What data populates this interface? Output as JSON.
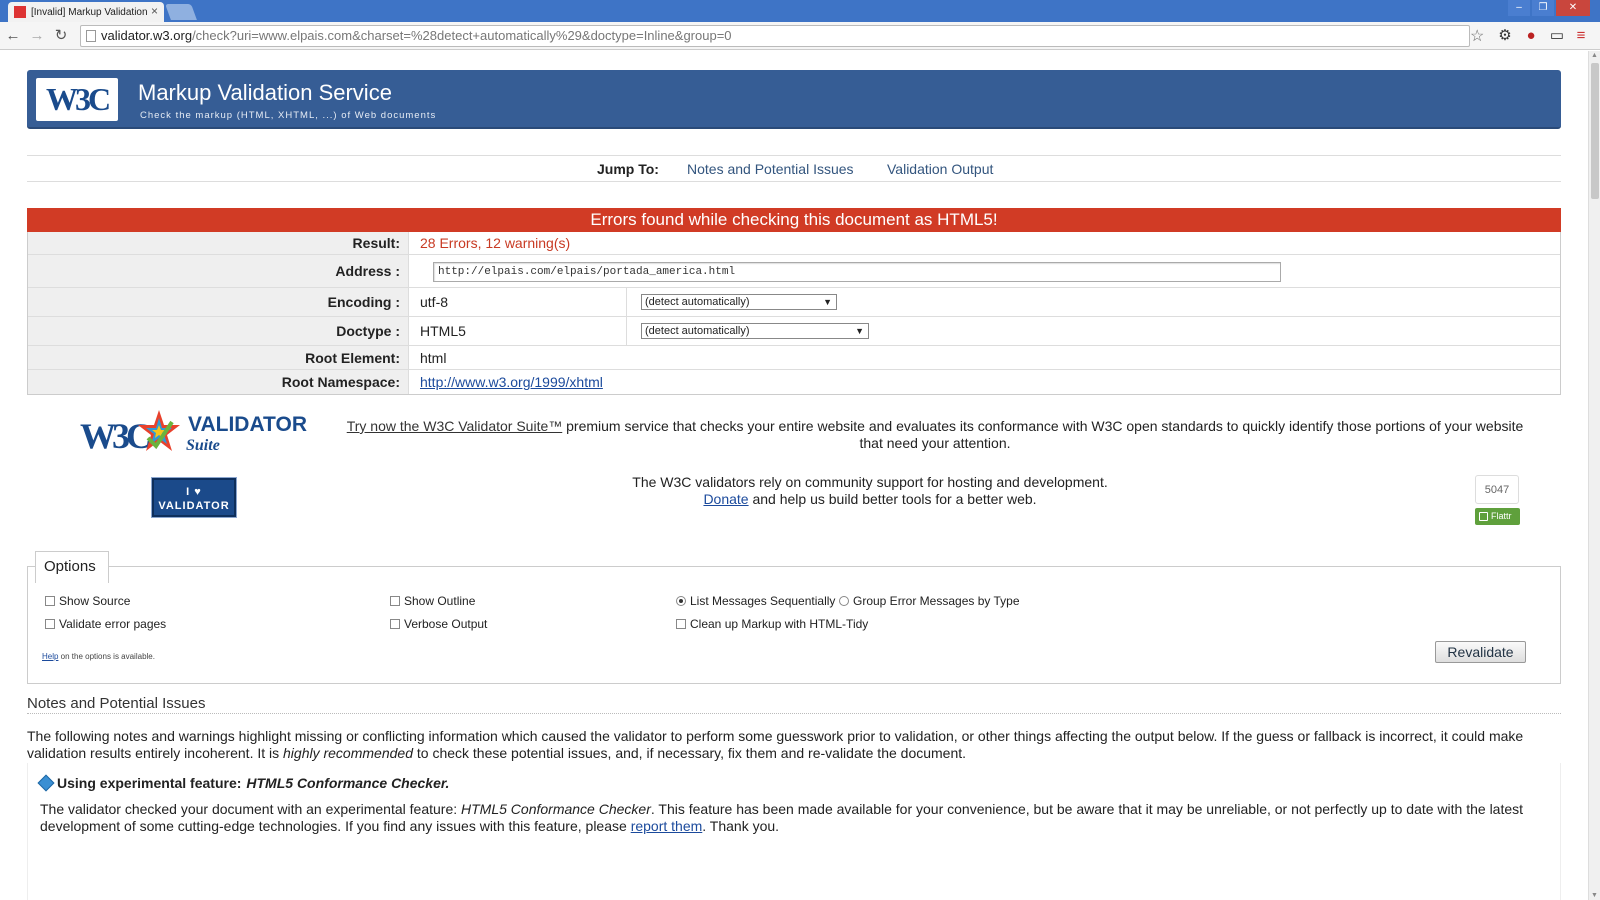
{
  "browser": {
    "tab_title": "[Invalid] Markup Validation o",
    "url_host": "validator.w3.org",
    "url_path": "/check?uri=www.elpais.com&charset=%28detect+automatically%29&doctype=Inline&group=0"
  },
  "header": {
    "logo_text": "W3C",
    "title": "Markup Validation Service",
    "subtitle": "Check the markup (HTML, XHTML, ...) of Web documents"
  },
  "jump": {
    "label": "Jump To:",
    "links": [
      "Notes and Potential Issues",
      "Validation Output"
    ]
  },
  "result": {
    "banner": "Errors found while checking this document as HTML5!",
    "rows": {
      "result_label": "Result:",
      "result_value": "28 Errors, 12 warning(s)",
      "address_label": "Address :",
      "address_value": "http://elpais.com/elpais/portada_america.html",
      "encoding_label": "Encoding :",
      "encoding_value": "utf-8",
      "encoding_select": "(detect automatically)",
      "doctype_label": "Doctype :",
      "doctype_value": "HTML5",
      "doctype_select": "(detect automatically)",
      "root_element_label": "Root Element:",
      "root_element_value": "html",
      "root_ns_label": "Root Namespace:",
      "root_ns_value": "http://www.w3.org/1999/xhtml"
    }
  },
  "promo": {
    "logo_w3c": "W3C",
    "logo_validator": "VALIDATOR",
    "logo_suite": "Suite",
    "link": "Try now the W3C Validator Suite™",
    "text": " premium service that checks your entire website and evaluates its conformance with W3C open standards to quickly identify those portions of your website that need your attention.",
    "badge_line1": "I ♥",
    "badge_line2": "VALIDATOR",
    "support_line1": "The W3C validators rely on community support for hosting and development.",
    "donate_link": "Donate",
    "support_line2": " and help us build better tools for a better web.",
    "flattr_count": "5047",
    "flattr_label": "Flattr"
  },
  "options": {
    "legend": "Options",
    "show_source": "Show Source",
    "show_outline": "Show Outline",
    "list_sequential": "List Messages Sequentially",
    "group_by_type": "Group Error Messages by Type",
    "validate_error_pages": "Validate error pages",
    "verbose_output": "Verbose Output",
    "cleanup_tidy": "Clean up Markup with HTML-Tidy",
    "help_link": "Help",
    "help_text": " on the options is available.",
    "revalidate": "Revalidate"
  },
  "notes": {
    "title": "Notes and Potential Issues",
    "intro_a": "The following notes and warnings highlight missing or conflicting information which caused the validator to perform some guesswork prior to validation, or other things affecting the output below. If the guess or fallback is incorrect, it could make validation results entirely incoherent. It is ",
    "intro_em": "highly recommended",
    "intro_b": " to check these potential issues, and, if necessary, fix them and re-validate the document.",
    "exp_head_a": "Using experimental feature: ",
    "exp_head_em": "HTML5 Conformance Checker.",
    "exp_text_a": "The validator checked your document with an experimental feature: ",
    "exp_text_em": "HTML5 Conformance Checker",
    "exp_text_b": ". This feature has been made available for your convenience, but be aware that it may be unreliable, or not perfectly up to date with the latest development of some cutting-edge technologies. If you find any issues with this feature, please ",
    "exp_link": "report them",
    "exp_text_c": ". Thank you."
  },
  "colors": {
    "banner_blue": "#365d95",
    "error_red": "#d13b25",
    "link_blue": "#1b4a9c"
  }
}
